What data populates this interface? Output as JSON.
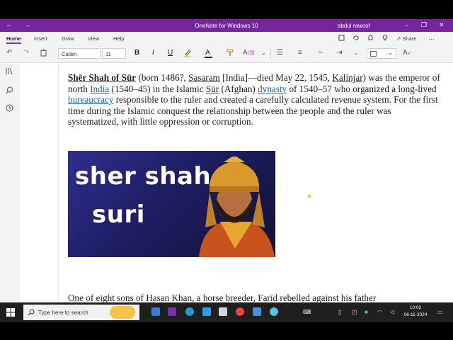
{
  "titlebar": {
    "back": "←",
    "forward": "→",
    "title": "OneNote for Windows 10",
    "user": "abdul rawoof",
    "minimize": "–",
    "maximize": "❐",
    "close": "✕"
  },
  "ribbon": {
    "tabs": [
      "Home",
      "Insert",
      "Draw",
      "View",
      "Help"
    ],
    "share": "Share"
  },
  "toolbar": {
    "font_name": "Calibri",
    "font_size": "11",
    "bold": "B",
    "italic": "I",
    "underline": "U",
    "font_color": "A"
  },
  "page": {
    "p1_title": "Shēr Shah of Sūr",
    "p1_a": " (born 1486?, ",
    "p1_sasaram": "Sasaram",
    "p1_b": " [India]—died May 22, 1545, ",
    "p1_kalinjar": "Kalinjar",
    "p1_c": ") was the emperor of north ",
    "p1_india": "India",
    "p1_d": " (1540–45) in the Islamic ",
    "p1_sur": "Sūr",
    "p1_e": " (Afghan) ",
    "p1_dynasty": "dynasty",
    "p1_f": " of 1540–57 who organized a long-lived ",
    "p1_bureaucracy": "bureaucracy",
    "p1_g": " responsible to the ruler and created a carefully calculated revenue system. For the first time during the Islamic conquest the relationship between the people and the ruler was systematized, with little oppression or corruption.",
    "image_line1": "sher shah",
    "image_line2": "suri",
    "p2_a": "One of eight sons of ",
    "p2_hasan": "Hasan Khan",
    "p2_b": ", a horse breeder, ",
    "p2_farid": "Farīd",
    "p2_c": " rebelled against his father"
  },
  "taskbar": {
    "search_placeholder": "Type here to search",
    "time": "10:02",
    "date": "06-11-2024"
  },
  "colors": {
    "onenote_purple": "#77259e",
    "link_blue": "#1a6aa6"
  }
}
